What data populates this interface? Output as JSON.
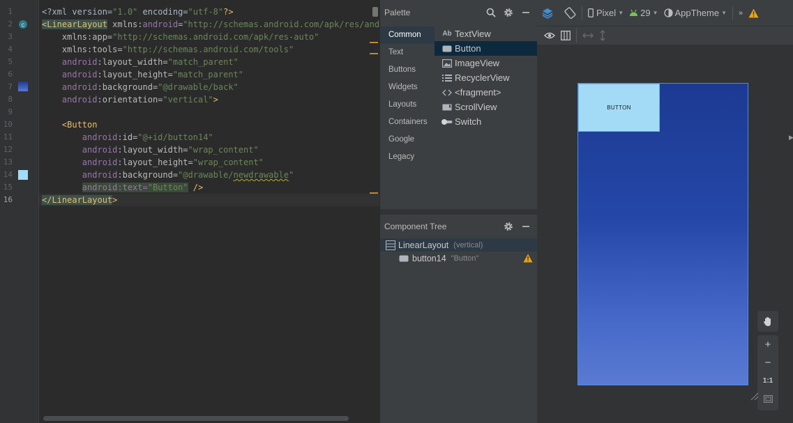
{
  "editor": {
    "line_numbers": [
      "1",
      "2",
      "3",
      "4",
      "5",
      "6",
      "7",
      "8",
      "9",
      "10",
      "11",
      "12",
      "13",
      "14",
      "15",
      "16"
    ],
    "current_line": "16",
    "lines": [
      [
        {
          "t": "<?xml version=",
          "c": "t-plain"
        },
        {
          "t": "\"1.0\"",
          "c": "t-val"
        },
        {
          "t": " encoding=",
          "c": "t-plain"
        },
        {
          "t": "\"utf-8\"",
          "c": "t-val"
        },
        {
          "t": "?>",
          "c": "t-tag"
        }
      ],
      [
        {
          "t": "<LinearLayout",
          "c": "t-tag hl-tag"
        },
        {
          "t": " xmlns:",
          "c": "t-attr"
        },
        {
          "t": "android",
          "c": "t-ns"
        },
        {
          "t": "=",
          "c": "t-plain"
        },
        {
          "t": "\"http://schemas.android.com/apk/res/android\"",
          "c": "t-val"
        }
      ],
      [
        {
          "t": "    xmlns:app=",
          "c": "t-attr"
        },
        {
          "t": "\"http://schemas.android.com/apk/res-auto\"",
          "c": "t-val"
        }
      ],
      [
        {
          "t": "    xmlns:tools=",
          "c": "t-attr"
        },
        {
          "t": "\"http://schemas.android.com/tools\"",
          "c": "t-val"
        }
      ],
      [
        {
          "t": "    android",
          "c": "t-ns"
        },
        {
          "t": ":layout_width=",
          "c": "t-attr"
        },
        {
          "t": "\"match_parent\"",
          "c": "t-val"
        }
      ],
      [
        {
          "t": "    android",
          "c": "t-ns"
        },
        {
          "t": ":layout_height=",
          "c": "t-attr"
        },
        {
          "t": "\"match_parent\"",
          "c": "t-val"
        }
      ],
      [
        {
          "t": "    android",
          "c": "t-ns"
        },
        {
          "t": ":background=",
          "c": "t-attr"
        },
        {
          "t": "\"@drawable/back\"",
          "c": "t-val"
        }
      ],
      [
        {
          "t": "    android",
          "c": "t-ns"
        },
        {
          "t": ":orientation=",
          "c": "t-attr"
        },
        {
          "t": "\"vertical\"",
          "c": "t-val"
        },
        {
          "t": ">",
          "c": "t-tag"
        }
      ],
      [
        {
          "t": "",
          "c": "t-plain"
        }
      ],
      [
        {
          "t": "    <Button",
          "c": "t-tag"
        }
      ],
      [
        {
          "t": "        android",
          "c": "t-ns"
        },
        {
          "t": ":id=",
          "c": "t-attr"
        },
        {
          "t": "\"@+id/button14\"",
          "c": "t-val"
        }
      ],
      [
        {
          "t": "        android",
          "c": "t-ns"
        },
        {
          "t": ":layout_width=",
          "c": "t-attr"
        },
        {
          "t": "\"wrap_content\"",
          "c": "t-val"
        }
      ],
      [
        {
          "t": "        android",
          "c": "t-ns"
        },
        {
          "t": ":layout_height=",
          "c": "t-attr"
        },
        {
          "t": "\"wrap_content\"",
          "c": "t-val"
        }
      ],
      [
        {
          "t": "        android",
          "c": "t-ns"
        },
        {
          "t": ":background=",
          "c": "t-attr"
        },
        {
          "t": "\"@drawable/",
          "c": "t-val"
        },
        {
          "t": "newdrawable",
          "c": "t-val warn-ul"
        },
        {
          "t": "\"",
          "c": "t-val"
        }
      ],
      [
        {
          "t": "        ",
          "c": "t-plain"
        },
        {
          "t": "android:text=",
          "c": "t-ns hl-text"
        },
        {
          "t": "\"Button\"",
          "c": "t-val hl-text"
        },
        {
          "t": " />",
          "c": "t-tag"
        }
      ],
      [
        {
          "t": "</LinearLayout",
          "c": "t-tag hl-tag"
        },
        {
          "t": ">",
          "c": "t-tag"
        }
      ]
    ]
  },
  "palette": {
    "title": "Palette",
    "categories": [
      "Common",
      "Text",
      "Buttons",
      "Widgets",
      "Layouts",
      "Containers",
      "Google",
      "Legacy"
    ],
    "selected_category": "Common",
    "items": [
      {
        "label": "TextView",
        "icon": "text-view-icon",
        "glyph": "Ab"
      },
      {
        "label": "Button",
        "icon": "button-icon",
        "glyph": ""
      },
      {
        "label": "ImageView",
        "icon": "image-view-icon",
        "glyph": ""
      },
      {
        "label": "RecyclerView",
        "icon": "recycler-view-icon",
        "glyph": ""
      },
      {
        "label": "<fragment>",
        "icon": "fragment-icon",
        "glyph": "<>"
      },
      {
        "label": "ScrollView",
        "icon": "scroll-view-icon",
        "glyph": ""
      },
      {
        "label": "Switch",
        "icon": "switch-icon",
        "glyph": ""
      }
    ],
    "selected_item": "Button"
  },
  "component_tree": {
    "title": "Component Tree",
    "root": {
      "name": "LinearLayout",
      "sub": "(vertical)"
    },
    "child": {
      "name": "button14",
      "sub": "\"Button\""
    }
  },
  "design": {
    "device": "Pixel",
    "api": "29",
    "theme": "AppTheme",
    "preview_button_text": "BUTTON",
    "zoom_labels": {
      "in": "+",
      "out": "−",
      "actual": "1:1"
    }
  },
  "colors": {
    "accent_blue": "#4a8de8",
    "android_green": "#78c257",
    "warning": "#f0a30a",
    "button_bg": "#a3dbf7"
  }
}
